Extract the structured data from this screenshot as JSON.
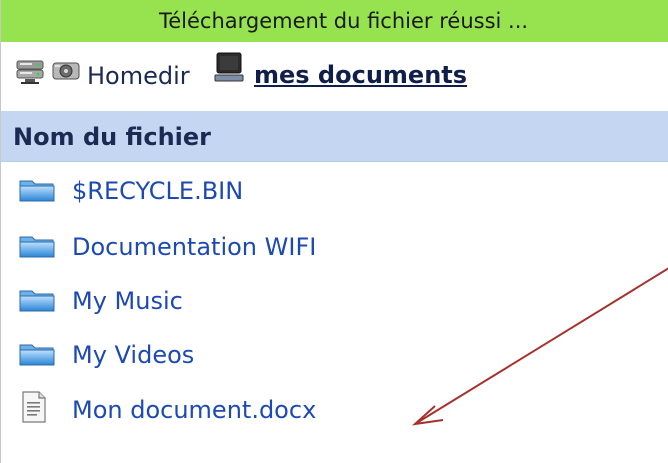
{
  "status": {
    "message": "Téléchargement du fichier réussi ..."
  },
  "path": {
    "root_icons": [
      "server-icon",
      "network-drive-icon"
    ],
    "homedir_label": "Homedir",
    "current_icon": "monitor-icon",
    "current_folder": "mes documents"
  },
  "table": {
    "header": "Nom du fichier"
  },
  "files": [
    {
      "name": "$RECYCLE.BIN",
      "type": "folder",
      "icon": "folder-icon"
    },
    {
      "name": "Documentation WIFI",
      "type": "folder",
      "icon": "folder-icon"
    },
    {
      "name": "My Music",
      "type": "folder",
      "icon": "folder-icon"
    },
    {
      "name": "My Videos",
      "type": "folder",
      "icon": "folder-icon"
    },
    {
      "name": "Mon document.docx",
      "type": "file",
      "icon": "document-icon"
    }
  ],
  "colors": {
    "status_bg": "#97e24f",
    "header_bg": "#c5d6f3",
    "link": "#1d49b3",
    "annotation_arrow": "#a6312c"
  }
}
